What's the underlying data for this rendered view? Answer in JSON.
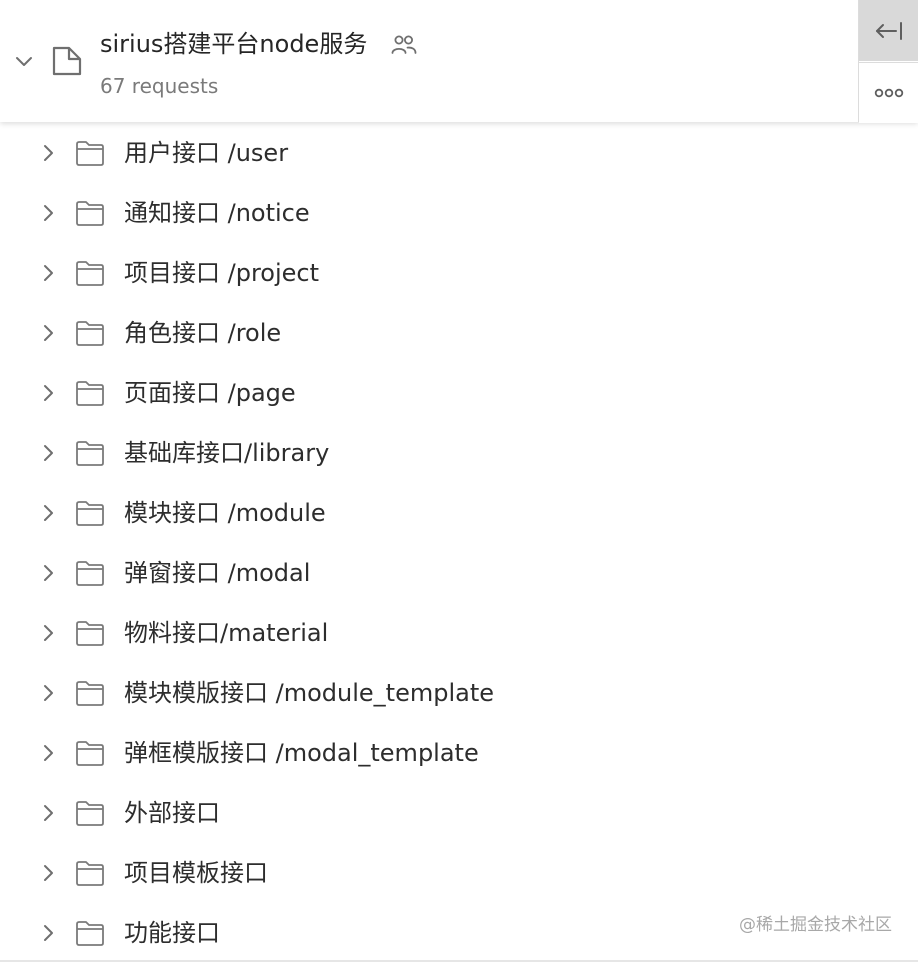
{
  "collection": {
    "title": "sirius搭建平台node服务",
    "subtitle": "67 requests",
    "team_icon": "team-icon",
    "folder_icon": "collection-icon",
    "chevron_icon": "chevron-down-icon"
  },
  "actions": {
    "collapse_icon": "collapse-left-icon",
    "more_icon": "more-horizontal-icon"
  },
  "folders": [
    {
      "label": "用户接口 /user"
    },
    {
      "label": "通知接口 /notice"
    },
    {
      "label": "项目接口 /project"
    },
    {
      "label": "角色接口 /role"
    },
    {
      "label": "页面接口 /page"
    },
    {
      "label": "基础库接口/library"
    },
    {
      "label": "模块接口 /module"
    },
    {
      "label": "弹窗接口 /modal"
    },
    {
      "label": "物料接口/material"
    },
    {
      "label": "模块模版接口 /module_template"
    },
    {
      "label": "弹框模版接口 /modal_template"
    },
    {
      "label": "外部接口"
    },
    {
      "label": "项目模板接口"
    },
    {
      "label": "功能接口"
    }
  ],
  "watermark": "@稀土掘金技术社区",
  "colors": {
    "icon_stroke": "#7a7a7a",
    "text": "#2d2d2d",
    "subtle_text": "#7a7a7a",
    "active_button_bg": "#d9d9d9"
  }
}
